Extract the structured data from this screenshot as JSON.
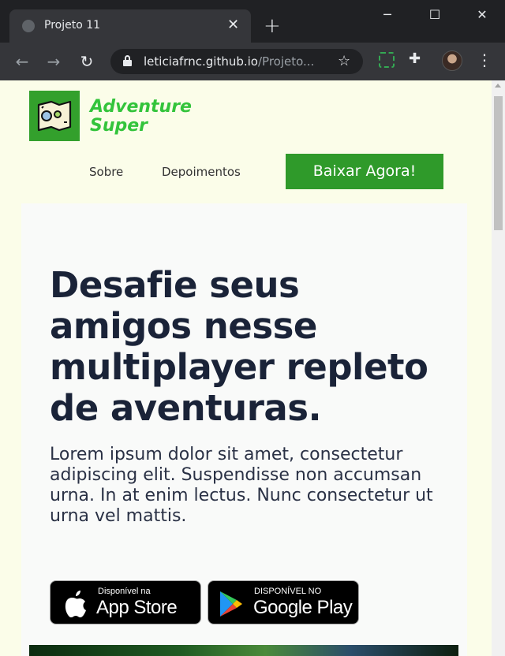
{
  "browser": {
    "tab_title": "Projeto 11",
    "url_host": "leticiafrnc.github.io",
    "url_path": "/Projeto...",
    "icons": {
      "favicon": "globe-icon",
      "tab_close": "close-icon",
      "new_tab": "plus-icon",
      "minimize": "minimize-icon",
      "maximize": "maximize-icon",
      "close": "close-icon",
      "back": "arrow-left-icon",
      "forward": "arrow-right-icon",
      "reload": "reload-icon",
      "lock": "lock-icon",
      "bookmark": "star-icon",
      "extension": "puzzle-icon",
      "menu": "kebab-icon"
    }
  },
  "site": {
    "brand_line1": "Adventure",
    "brand_line2": "Super",
    "nav": {
      "about": "Sobre",
      "testimonials": "Depoimentos"
    },
    "cta_label": "Baixar Agora!",
    "hero": {
      "headline": "Desafie seus amigos nesse multiplayer repleto de aventuras.",
      "lead": "Lorem ipsum dolor sit amet, consectetur adipiscing elit. Suspendisse non accumsan urna. In at enim lectus. Nunc consectetur ut urna vel mattis."
    },
    "stores": {
      "apple_small": "Disponível na",
      "apple_big": "App Store",
      "google_small": "DISPONÍVEL NO",
      "google_big": "Google Play"
    }
  },
  "colors": {
    "page_bg": "#fbfde9",
    "brand_green": "#33c43b",
    "cta_green": "#2f9a2a",
    "headline": "#1a2338"
  }
}
